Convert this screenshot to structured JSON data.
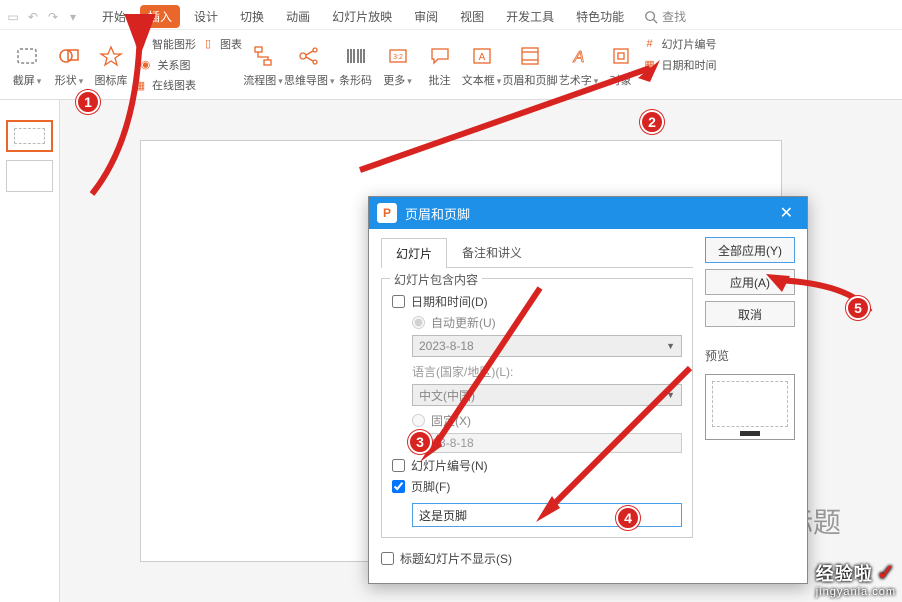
{
  "tabs": {
    "items": [
      "开始",
      "插入",
      "设计",
      "切换",
      "动画",
      "幻灯片放映",
      "审阅",
      "视图",
      "开发工具",
      "特色功能"
    ],
    "activeIndex": 1,
    "search": "查找"
  },
  "ribbon": {
    "cutscreen": "截屏",
    "shape": "形状",
    "iconlib": "图标库",
    "smartshape": "智能图形",
    "chart": "图表",
    "relation": "关系图",
    "onlinechart": "在线图表",
    "flowchart": "流程图",
    "mindmap": "思维导图",
    "barcode": "条形码",
    "more": "更多",
    "comment": "批注",
    "textbox": "文本框",
    "headerfooter": "页眉和页脚",
    "wordart": "艺术字",
    "object": "对象",
    "slidenum": "幻灯片编号",
    "datetime": "日期和时间"
  },
  "canvas": {
    "titlePlaceholder": "标题"
  },
  "dialog": {
    "title": "页眉和页脚",
    "tabs": [
      "幻灯片",
      "备注和讲义"
    ],
    "activeTab": 0,
    "groupTitle": "幻灯片包含内容",
    "dateTime": "日期和时间(D)",
    "autoUpdate": "自动更新(U)",
    "dateValue": "2023-8-18",
    "langLabel": "语言(国家/地区)(L):",
    "langValue": "中文(中国)",
    "fixed": "固定(X)",
    "fixedValue": "2023-8-18",
    "slideNum": "幻灯片编号(N)",
    "footer": "页脚(F)",
    "footerValue": "这是页脚",
    "titleHide": "标题幻灯片不显示(S)",
    "applyAll": "全部应用(Y)",
    "apply": "应用(A)",
    "cancel": "取消",
    "previewLabel": "预览"
  },
  "badges": [
    "1",
    "2",
    "3",
    "4",
    "5"
  ],
  "watermark": {
    "big": "经验啦",
    "small": "jingyanla.com"
  }
}
